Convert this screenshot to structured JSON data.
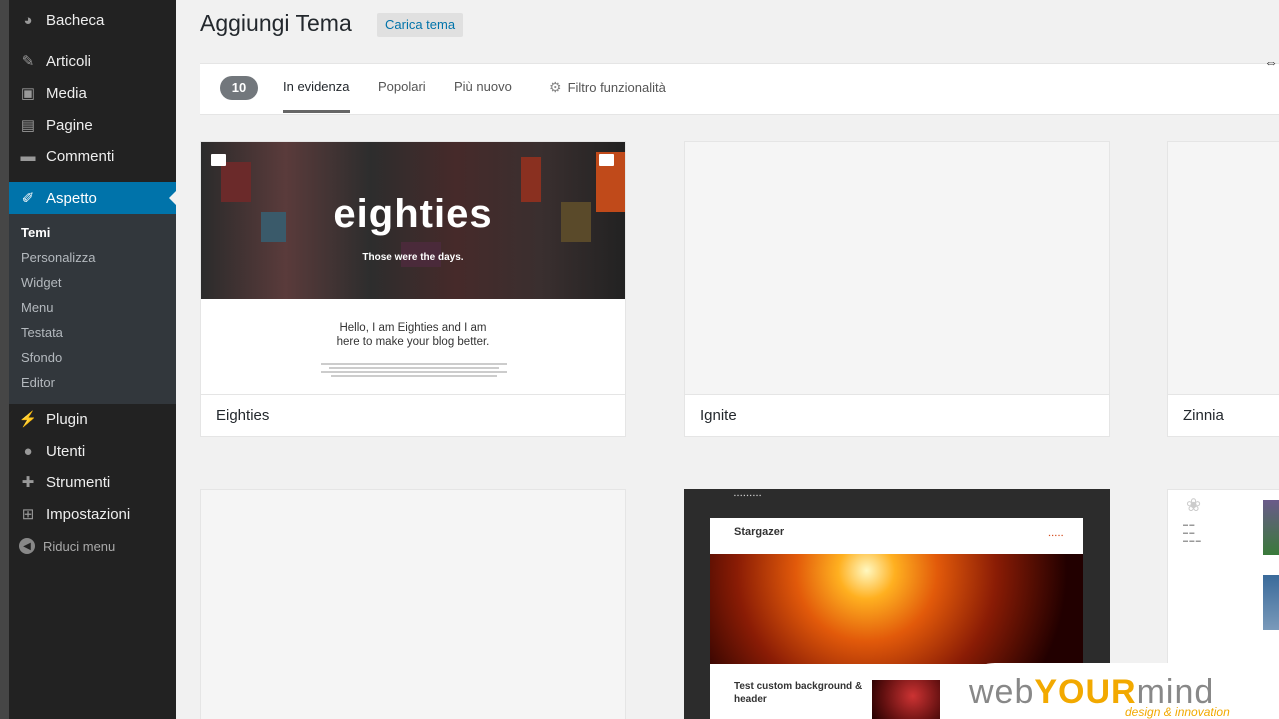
{
  "sidebar": {
    "items": [
      {
        "label": "Bacheca",
        "icon": "dashboard-icon"
      },
      {
        "label": "Articoli",
        "icon": "pin-icon"
      },
      {
        "label": "Media",
        "icon": "media-icon"
      },
      {
        "label": "Pagine",
        "icon": "pages-icon"
      },
      {
        "label": "Commenti",
        "icon": "comments-icon"
      },
      {
        "label": "Aspetto",
        "icon": "appearance-icon"
      },
      {
        "label": "Plugin",
        "icon": "plugin-icon"
      },
      {
        "label": "Utenti",
        "icon": "users-icon"
      },
      {
        "label": "Strumenti",
        "icon": "tools-icon"
      },
      {
        "label": "Impostazioni",
        "icon": "settings-icon"
      }
    ],
    "submenu": [
      "Temi",
      "Personalizza",
      "Widget",
      "Menu",
      "Testata",
      "Sfondo",
      "Editor"
    ],
    "collapse_label": "Riduci menu"
  },
  "header": {
    "title": "Aggiungi Tema",
    "upload_label": "Carica tema"
  },
  "filter": {
    "count": "10",
    "tabs": [
      "In evidenza",
      "Popolari",
      "Più nuovo"
    ],
    "feature_filter": "Filtro funzionalità"
  },
  "themes": [
    {
      "name": "Eighties"
    },
    {
      "name": "Ignite"
    },
    {
      "name": "Zinnia"
    }
  ],
  "eighties_preview": {
    "hero_title": "eighties",
    "hero_sub": "Those were the days.",
    "hello_line1": "Hello, I am Eighties and I am",
    "hello_line2": "here to make your blog better."
  },
  "stargazer_preview": {
    "title": "Stargazer",
    "post_title": "Test custom background & header"
  },
  "watermark": {
    "logo_pre": "web",
    "logo_mid": "YOUR",
    "logo_post": "mind",
    "tagline": "design & innovation"
  }
}
